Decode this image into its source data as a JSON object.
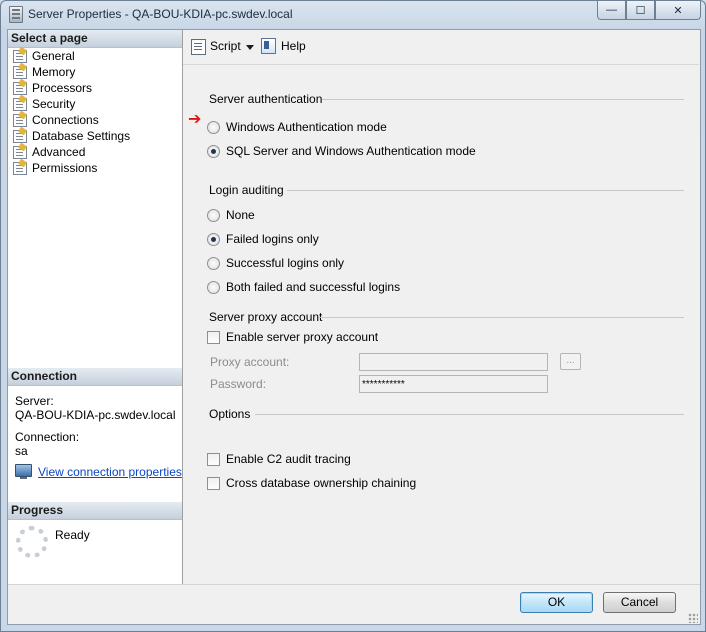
{
  "window": {
    "title": "Server Properties - QA-BOU-KDIA-pc.swdev.local",
    "minimize_symbol": "—",
    "maximize_symbol": "☐",
    "close_symbol": "✕"
  },
  "sidebar": {
    "select_page_heading": "Select a page",
    "pages": [
      {
        "label": "General",
        "icon": "page-settings-icon"
      },
      {
        "label": "Memory",
        "icon": "page-settings-icon"
      },
      {
        "label": "Processors",
        "icon": "page-settings-icon"
      },
      {
        "label": "Security",
        "icon": "page-settings-icon"
      },
      {
        "label": "Connections",
        "icon": "page-settings-icon"
      },
      {
        "label": "Database Settings",
        "icon": "page-settings-icon"
      },
      {
        "label": "Advanced",
        "icon": "page-settings-icon"
      },
      {
        "label": "Permissions",
        "icon": "page-settings-icon"
      }
    ],
    "connection": {
      "heading": "Connection",
      "server_label": "Server:",
      "server_value": "QA-BOU-KDIA-pc.swdev.local",
      "connection_label": "Connection:",
      "connection_value": "sa",
      "view_link": "View connection properties"
    },
    "progress": {
      "heading": "Progress",
      "status": "Ready"
    }
  },
  "toolbar": {
    "script_label": "Script",
    "help_label": "Help"
  },
  "security": {
    "server_auth": {
      "title": "Server authentication",
      "options": [
        {
          "label": "Windows Authentication mode",
          "checked": false
        },
        {
          "label": "SQL Server and Windows Authentication mode",
          "checked": true
        }
      ],
      "marker": "➔"
    },
    "login_auditing": {
      "title": "Login auditing",
      "options": [
        {
          "label": "None",
          "checked": false
        },
        {
          "label": "Failed logins only",
          "checked": true
        },
        {
          "label": "Successful logins only",
          "checked": false
        },
        {
          "label": "Both failed and successful logins",
          "checked": false
        }
      ]
    },
    "proxy": {
      "title": "Server proxy account",
      "enable_label": "Enable server proxy account",
      "enable_checked": false,
      "proxy_account_label": "Proxy account:",
      "proxy_account_value": "",
      "password_label": "Password:",
      "password_value": "***********",
      "browse_label": "..."
    },
    "options": {
      "title": "Options",
      "c2_label": "Enable C2 audit tracing",
      "c2_checked": false,
      "chaining_label": "Cross database ownership chaining",
      "chaining_checked": false
    }
  },
  "footer": {
    "ok_label": "OK",
    "cancel_label": "Cancel"
  }
}
